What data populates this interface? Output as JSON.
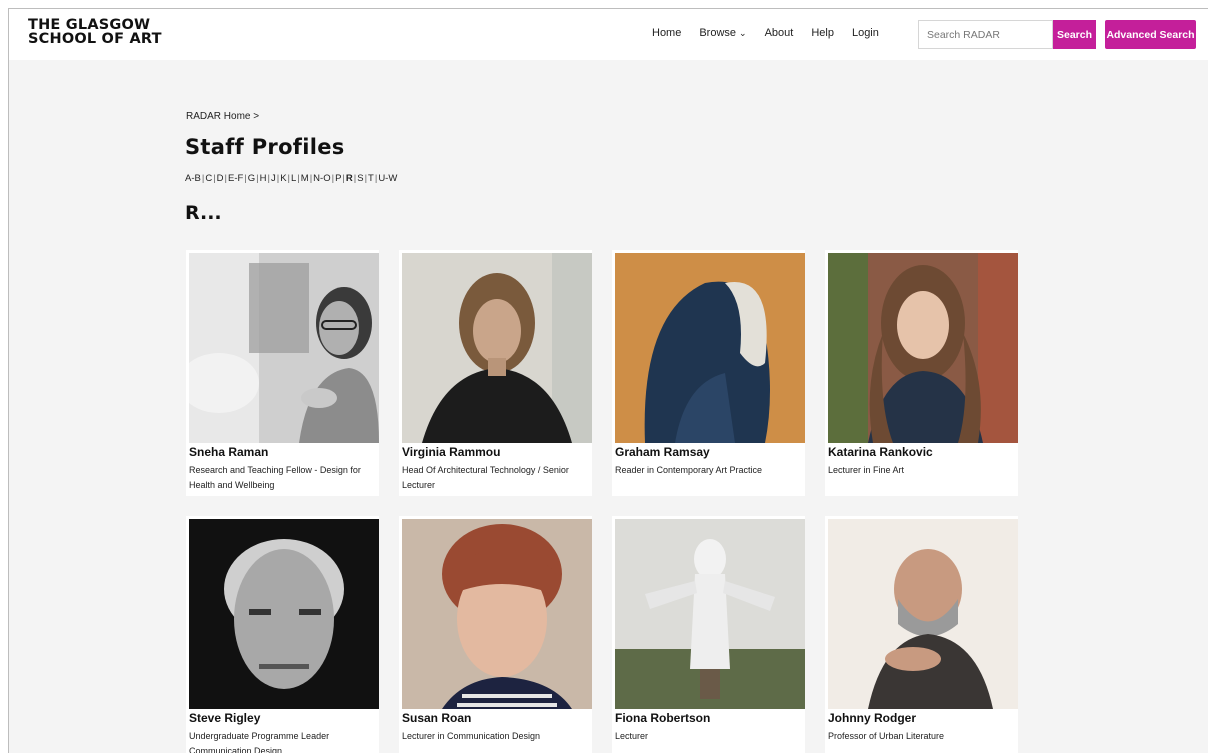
{
  "header": {
    "logo_line1": "THE GLASGOW",
    "logo_line2": "SCHOOL OF ART",
    "nav": [
      "Home",
      "Browse",
      "About",
      "Help",
      "Login"
    ],
    "search_placeholder": "Search RADAR",
    "search_button": "Search",
    "advanced_button": "Advanced Search",
    "accent": "#c41f9a"
  },
  "breadcrumb": "RADAR Home >",
  "page_title": "Staff Profiles",
  "az_index": {
    "items": [
      "A-B",
      "C",
      "D",
      "E-F",
      "G",
      "H",
      "J",
      "K",
      "L",
      "M",
      "N-O",
      "P",
      "R",
      "S",
      "T",
      "U-W"
    ],
    "current": "R"
  },
  "letter_heading": "R...",
  "staff": [
    {
      "name": "Sneha Raman",
      "role": "Research and Teaching Fellow - Design for Health and Wellbeing"
    },
    {
      "name": "Virginia Rammou",
      "role": "Head Of Architectural Technology / Senior Lecturer"
    },
    {
      "name": "Graham Ramsay",
      "role": "Reader in Contemporary Art Practice"
    },
    {
      "name": "Katarina Rankovic",
      "role": "Lecturer in Fine Art"
    },
    {
      "name": "Steve Rigley",
      "role": "Undergraduate Programme Leader Communication Design"
    },
    {
      "name": "Susan Roan",
      "role": "Lecturer in Communication Design"
    },
    {
      "name": "Fiona Robertson",
      "role": "Lecturer"
    },
    {
      "name": "Johnny Rodger",
      "role": "Professor of Urban Literature"
    }
  ]
}
